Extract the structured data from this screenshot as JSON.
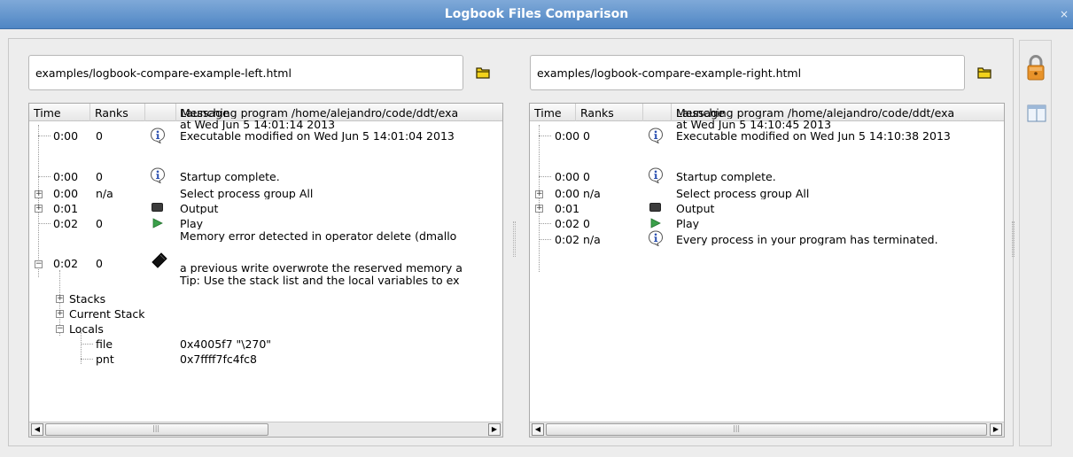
{
  "window": {
    "title": "Logbook Files Comparison",
    "close_glyph": "×"
  },
  "colors": {
    "titlebar": "#5b8fcb",
    "info_icon": "#2a4fb0",
    "play": "#3aa04a",
    "lock": "#e8932a"
  },
  "left": {
    "path": "examples/logbook-compare-example-left.html",
    "columns": [
      "Time",
      "Ranks",
      "",
      "Message"
    ],
    "rows": [
      {
        "time": "0:00",
        "ranks": "0",
        "icon": "info-icon",
        "msg": [
          "Launching program /home/alejandro/code/ddt/exa",
          "at Wed Jun 5 14:01:14 2013",
          "Executable modified on Wed Jun 5 14:01:04 2013"
        ]
      },
      {
        "time": "0:00",
        "ranks": "0",
        "icon": "info-icon",
        "msg": [
          "Startup complete."
        ]
      },
      {
        "time": "0:00",
        "ranks": "n/a",
        "icon": "",
        "msg": [
          "Select process group All"
        ]
      },
      {
        "time": "0:01",
        "ranks": "",
        "icon": "output-icon",
        "msg": [
          "Output"
        ]
      },
      {
        "time": "0:02",
        "ranks": "0",
        "icon": "play-icon",
        "msg": [
          "Play"
        ]
      },
      {
        "time": "0:02",
        "ranks": "0",
        "icon": "memory-error-icon",
        "msg": [
          "Memory error detected in operator delete (dmallo",
          "",
          "a previous write overwrote the reserved memory a",
          "Tip: Use the stack list and the local variables to ex"
        ]
      }
    ],
    "children": [
      {
        "label": "Stacks",
        "value": ""
      },
      {
        "label": "Current Stack",
        "value": ""
      },
      {
        "label": "Locals",
        "value": ""
      },
      {
        "label": "file",
        "value": "0x4005f7 \"\\270\""
      },
      {
        "label": "pnt",
        "value": "0x7ffff7fc4fc8"
      }
    ],
    "scroll_grip": "|||"
  },
  "right": {
    "path": "examples/logbook-compare-example-right.html",
    "columns": [
      "Time",
      "Ranks",
      "",
      "Message"
    ],
    "rows": [
      {
        "time": "0:00",
        "ranks": "0",
        "icon": "info-icon",
        "msg": [
          "Launching program /home/alejandro/code/ddt/exa",
          "at Wed Jun 5 14:10:45 2013",
          "Executable modified on Wed Jun 5 14:10:38 2013"
        ]
      },
      {
        "time": "0:00",
        "ranks": "0",
        "icon": "info-icon",
        "msg": [
          "Startup complete."
        ]
      },
      {
        "time": "0:00",
        "ranks": "n/a",
        "icon": "",
        "msg": [
          "Select process group All"
        ]
      },
      {
        "time": "0:01",
        "ranks": "",
        "icon": "output-icon",
        "msg": [
          "Output"
        ]
      },
      {
        "time": "0:02",
        "ranks": "0",
        "icon": "play-icon",
        "msg": [
          "Play"
        ]
      },
      {
        "time": "0:02",
        "ranks": "n/a",
        "icon": "info-icon",
        "msg": [
          "Every process in your program has terminated."
        ]
      }
    ],
    "scroll_grip": "|||"
  },
  "toolbar": {
    "lock": "lock-icon",
    "layout": "split-layout-icon"
  }
}
